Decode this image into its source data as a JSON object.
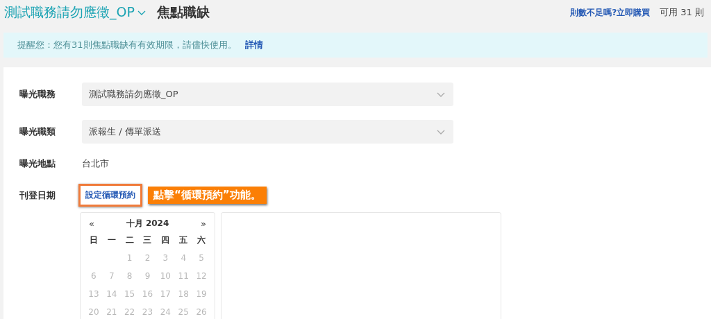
{
  "header": {
    "job_title": "測試職務請勿應徵_OP",
    "page_title": "焦點職缺",
    "buy_link": "則數不足嗎?立即購買",
    "available": "可用 31 則"
  },
  "notice": {
    "text": "提醒您：您有31則焦點職缺有有效期限，請儘快使用。",
    "link": "詳情"
  },
  "form": [
    {
      "kind": "select",
      "label": "曝光職務",
      "value": "測試職務請勿應徵_OP"
    },
    {
      "kind": "select",
      "label": "曝光職類",
      "value": "派報生 / 傳單派送"
    },
    {
      "kind": "text",
      "label": "曝光地點",
      "value": "台北市"
    },
    {
      "kind": "date",
      "label": "刊登日期",
      "button": "設定循環預約",
      "highlighted": true,
      "callout": "點擊“循環預約”功能。"
    }
  ],
  "calendar": {
    "prev": "«",
    "month": "十月 2024",
    "next": "»",
    "weekdays": [
      "日",
      "一",
      "二",
      "三",
      "四",
      "五",
      "六"
    ],
    "weeks": [
      {
        "days": [
          {
            "day": "1",
            "disabled": true
          },
          {
            "day": "2",
            "disabled": true
          },
          {
            "day": "3",
            "disabled": true
          },
          {
            "day": "4",
            "disabled": true
          },
          {
            "day": "5",
            "disabled": true
          }
        ]
      },
      {
        "days": [
          {
            "day": "6",
            "disabled": true
          },
          {
            "day": "7",
            "disabled": true
          },
          {
            "day": "8",
            "disabled": true
          },
          {
            "day": "9",
            "disabled": true
          },
          {
            "day": "10",
            "disabled": true
          },
          {
            "day": "11",
            "disabled": true
          },
          {
            "day": "12",
            "disabled": true
          }
        ]
      },
      {
        "days": [
          {
            "day": "13",
            "disabled": true
          },
          {
            "day": "14",
            "disabled": true
          },
          {
            "day": "15",
            "disabled": true
          },
          {
            "day": "16",
            "disabled": true
          },
          {
            "day": "17",
            "disabled": true
          },
          {
            "day": "18",
            "disabled": true
          },
          {
            "day": "19",
            "disabled": true
          }
        ]
      },
      {
        "days": [
          {
            "day": "20",
            "disabled": true
          },
          {
            "day": "21",
            "disabled": true
          },
          {
            "day": "22",
            "disabled": true
          },
          {
            "day": "23",
            "disabled": true
          },
          {
            "day": "24",
            "disabled": true
          },
          {
            "day": "25",
            "disabled": true
          },
          {
            "day": "26",
            "disabled": true
          }
        ]
      }
    ]
  }
}
